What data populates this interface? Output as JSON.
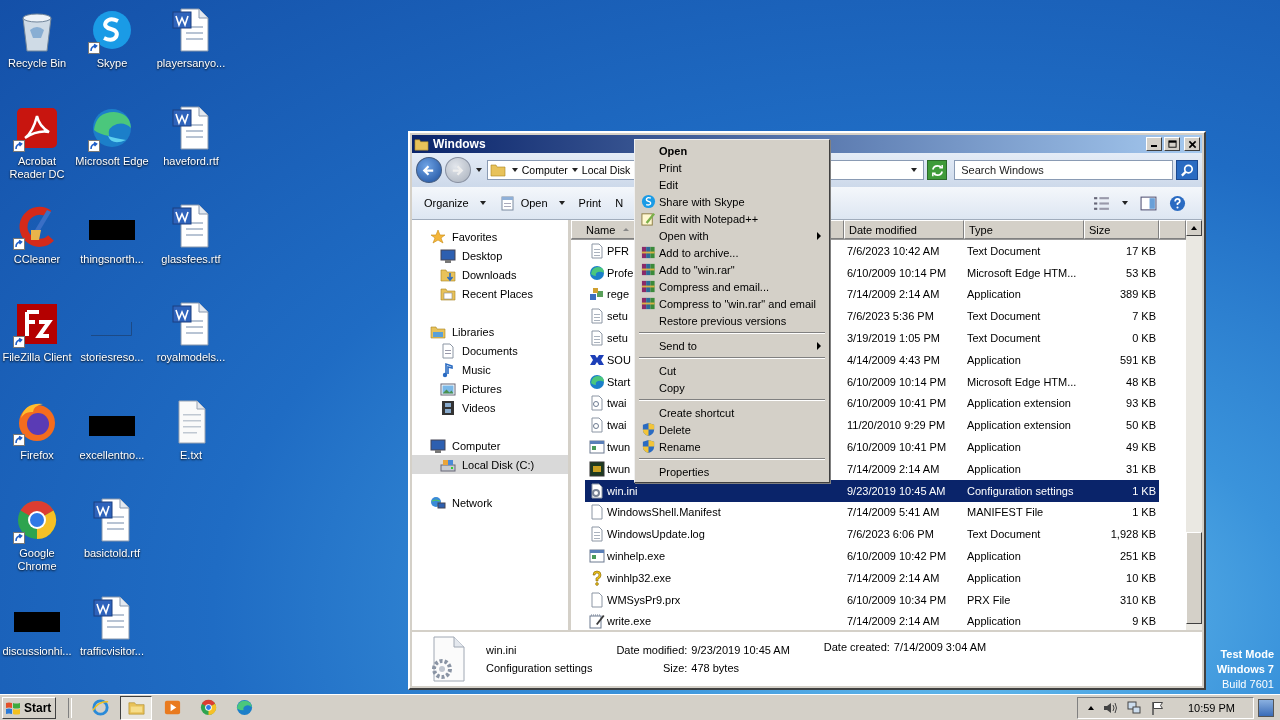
{
  "desktop": {
    "icons": [
      {
        "label": "Recycle Bin",
        "kind": "recycle-bin",
        "shortcut": false
      },
      {
        "label": "Acrobat Reader DC",
        "kind": "acrobat",
        "shortcut": true
      },
      {
        "label": "CCleaner",
        "kind": "ccleaner",
        "shortcut": true
      },
      {
        "label": "FileZilla Client",
        "kind": "filezilla",
        "shortcut": true
      },
      {
        "label": "Firefox",
        "kind": "firefox",
        "shortcut": true
      },
      {
        "label": "Google Chrome",
        "kind": "chrome",
        "shortcut": true
      },
      {
        "label": "discussionhi...",
        "kind": "redacted",
        "shortcut": false
      },
      {
        "label": "Skype",
        "kind": "skype",
        "shortcut": true
      },
      {
        "label": "Microsoft Edge",
        "kind": "edge",
        "shortcut": true
      },
      {
        "label": "thingsnorth...",
        "kind": "redacted",
        "shortcut": false
      },
      {
        "label": "storiesreso...",
        "kind": "blank-image",
        "shortcut": false
      },
      {
        "label": "excellentno...",
        "kind": "redacted",
        "shortcut": false
      },
      {
        "label": "basictold.rtf",
        "kind": "word",
        "shortcut": false
      },
      {
        "label": "trafficvisitor...",
        "kind": "word",
        "shortcut": false
      },
      {
        "label": "playersanyo...",
        "kind": "word",
        "shortcut": false
      },
      {
        "label": "haveford.rtf",
        "kind": "word",
        "shortcut": false
      },
      {
        "label": "glassfees.rtf",
        "kind": "word",
        "shortcut": false
      },
      {
        "label": "royalmodels...",
        "kind": "word",
        "shortcut": false
      },
      {
        "label": "E.txt",
        "kind": "text",
        "shortcut": false
      }
    ],
    "mode_text": [
      {
        "text": "Test Mode",
        "bold": true
      },
      {
        "text": "Windows 7",
        "bold": true
      },
      {
        "text": "Build 7601",
        "bold": false
      }
    ]
  },
  "explorer": {
    "title": "Windows",
    "breadcrumb": [
      "Computer",
      "Local Disk"
    ],
    "search": {
      "placeholder": "Search Windows"
    },
    "toolbar": [
      {
        "label": "Organize",
        "dropdown": true,
        "kind": "plain"
      },
      {
        "label": "Open",
        "dropdown": true,
        "kind": "open"
      },
      {
        "label": "Print",
        "dropdown": false,
        "kind": "plain"
      },
      {
        "label": "N",
        "dropdown": false,
        "kind": "plain"
      }
    ],
    "nav": [
      {
        "label": "Favorites",
        "kind": "star",
        "selected": false,
        "children": [
          {
            "label": "Desktop",
            "kind": "desktop",
            "selected": false
          },
          {
            "label": "Downloads",
            "kind": "downloads",
            "selected": false
          },
          {
            "label": "Recent Places",
            "kind": "recent",
            "selected": false
          }
        ]
      },
      {
        "label": "Libraries",
        "kind": "libraries",
        "selected": false,
        "children": [
          {
            "label": "Documents",
            "kind": "documents",
            "selected": false
          },
          {
            "label": "Music",
            "kind": "music",
            "selected": false
          },
          {
            "label": "Pictures",
            "kind": "pictures",
            "selected": false
          },
          {
            "label": "Videos",
            "kind": "videos",
            "selected": false
          }
        ]
      },
      {
        "label": "Computer",
        "kind": "computer",
        "selected": false,
        "children": [
          {
            "label": "Local Disk (C:)",
            "kind": "disk",
            "selected": true
          }
        ]
      },
      {
        "label": "Network",
        "kind": "network",
        "selected": false
      }
    ],
    "columns": [
      {
        "label": "Name",
        "sorted": true
      },
      {
        "label": "Date modified",
        "sorted": false
      },
      {
        "label": "Type",
        "sorted": false
      },
      {
        "label": "Size",
        "sorted": false
      }
    ],
    "rows": [
      {
        "name": "PFR",
        "date": "7/6/2023 10:42 AM",
        "type": "Text Document",
        "size": "17 KB",
        "kind": "text",
        "selected": false
      },
      {
        "name": "Profe",
        "date": "6/10/2009 10:14 PM",
        "type": "Microsoft Edge HTM...",
        "size": "53 KB",
        "kind": "edge",
        "selected": false
      },
      {
        "name": "rege",
        "date": "7/14/2009 2:14 AM",
        "type": "Application",
        "size": "389 KB",
        "kind": "cubes",
        "selected": false
      },
      {
        "name": "setu",
        "date": "7/6/2023 5:36 PM",
        "type": "Text Document",
        "size": "7 KB",
        "kind": "text",
        "selected": false
      },
      {
        "name": "setu",
        "date": "3/19/2019 1:05 PM",
        "type": "Text Document",
        "size": "0 KB",
        "kind": "text",
        "selected": false
      },
      {
        "name": "SOU",
        "date": "4/14/2009 4:43 PM",
        "type": "Application",
        "size": "591 KB",
        "kind": "sound",
        "selected": false
      },
      {
        "name": "Start",
        "date": "6/10/2009 10:14 PM",
        "type": "Microsoft Edge HTM...",
        "size": "48 KB",
        "kind": "edge",
        "selected": false
      },
      {
        "name": "twai",
        "date": "6/10/2009 10:41 PM",
        "type": "Application extension",
        "size": "93 KB",
        "kind": "dll",
        "selected": false
      },
      {
        "name": "twai",
        "date": "11/20/2010 9:29 PM",
        "type": "Application extension",
        "size": "50 KB",
        "kind": "dll",
        "selected": false
      },
      {
        "name": "twun",
        "date": "6/10/2009 10:41 PM",
        "type": "Application",
        "size": "49 KB",
        "kind": "window-app",
        "selected": false
      },
      {
        "name": "twun",
        "date": "7/14/2009 2:14 AM",
        "type": "Application",
        "size": "31 KB",
        "kind": "console",
        "selected": false
      },
      {
        "name": "win.ini",
        "date": "9/23/2019 10:45 AM",
        "type": "Configuration settings",
        "size": "1 KB",
        "kind": "config",
        "selected": true
      },
      {
        "name": "WindowsShell.Manifest",
        "date": "7/14/2009 5:41 AM",
        "type": "MANIFEST File",
        "size": "1 KB",
        "kind": "blank",
        "selected": false
      },
      {
        "name": "WindowsUpdate.log",
        "date": "7/6/2023 6:06 PM",
        "type": "Text Document",
        "size": "1,928 KB",
        "kind": "text",
        "selected": false
      },
      {
        "name": "winhelp.exe",
        "date": "6/10/2009 10:42 PM",
        "type": "Application",
        "size": "251 KB",
        "kind": "window-app",
        "selected": false
      },
      {
        "name": "winhlp32.exe",
        "date": "7/14/2009 2:14 AM",
        "type": "Application",
        "size": "10 KB",
        "kind": "help",
        "selected": false
      },
      {
        "name": "WMSysPr9.prx",
        "date": "6/10/2009 10:34 PM",
        "type": "PRX File",
        "size": "310 KB",
        "kind": "blank",
        "selected": false
      },
      {
        "name": "write.exe",
        "date": "7/14/2009 2:14 AM",
        "type": "Application",
        "size": "9 KB",
        "kind": "write",
        "selected": false
      }
    ],
    "details": {
      "name": "win.ini",
      "type": "Configuration settings",
      "fields": [
        {
          "label": "Date modified:",
          "value": "9/23/2019 10:45 AM"
        },
        {
          "label": "Size:",
          "value": "478 bytes"
        },
        {
          "label": "Date created:",
          "value": "7/14/2009 3:04 AM"
        }
      ]
    }
  },
  "context_menu": {
    "items": [
      {
        "label": "Open",
        "kind": "plain",
        "bold": true,
        "submenu": false
      },
      {
        "label": "Print",
        "kind": "plain",
        "bold": false,
        "submenu": false
      },
      {
        "label": "Edit",
        "kind": "plain",
        "bold": false,
        "submenu": false
      },
      {
        "label": "Share with Skype",
        "kind": "skype",
        "bold": false,
        "submenu": false
      },
      {
        "label": "Edit with Notepad++",
        "kind": "notepad",
        "bold": false,
        "submenu": false
      },
      {
        "label": "Open with",
        "kind": "plain",
        "bold": false,
        "submenu": true
      },
      {
        "label": "Add to archive...",
        "kind": "archive",
        "bold": false,
        "submenu": false
      },
      {
        "label": "Add to \"win.rar\"",
        "kind": "archive",
        "bold": false,
        "submenu": false
      },
      {
        "label": "Compress and email...",
        "kind": "archive",
        "bold": false,
        "submenu": false
      },
      {
        "label": "Compress to \"win.rar\" and email",
        "kind": "archive",
        "bold": false,
        "submenu": false
      },
      {
        "label": "Restore previous versions",
        "kind": "plain",
        "bold": false,
        "submenu": false
      },
      {
        "kind": "separator"
      },
      {
        "label": "Send to",
        "kind": "plain",
        "bold": false,
        "submenu": true
      },
      {
        "kind": "separator"
      },
      {
        "label": "Cut",
        "kind": "plain",
        "bold": false,
        "submenu": false
      },
      {
        "label": "Copy",
        "kind": "plain",
        "bold": false,
        "submenu": false
      },
      {
        "kind": "separator"
      },
      {
        "label": "Create shortcut",
        "kind": "plain",
        "bold": false,
        "submenu": false
      },
      {
        "label": "Delete",
        "kind": "shield",
        "bold": false,
        "submenu": false
      },
      {
        "label": "Rename",
        "kind": "shield",
        "bold": false,
        "submenu": false
      },
      {
        "kind": "separator"
      },
      {
        "label": "Properties",
        "kind": "plain",
        "bold": false,
        "submenu": false
      }
    ]
  },
  "taskbar": {
    "start": "Start",
    "items": [
      {
        "kind": "ie",
        "selected": false
      },
      {
        "kind": "explorer",
        "selected": true
      },
      {
        "kind": "media",
        "selected": false
      },
      {
        "kind": "chrome",
        "selected": false
      },
      {
        "kind": "edge",
        "selected": false
      }
    ],
    "clock": "10:59 PM"
  }
}
